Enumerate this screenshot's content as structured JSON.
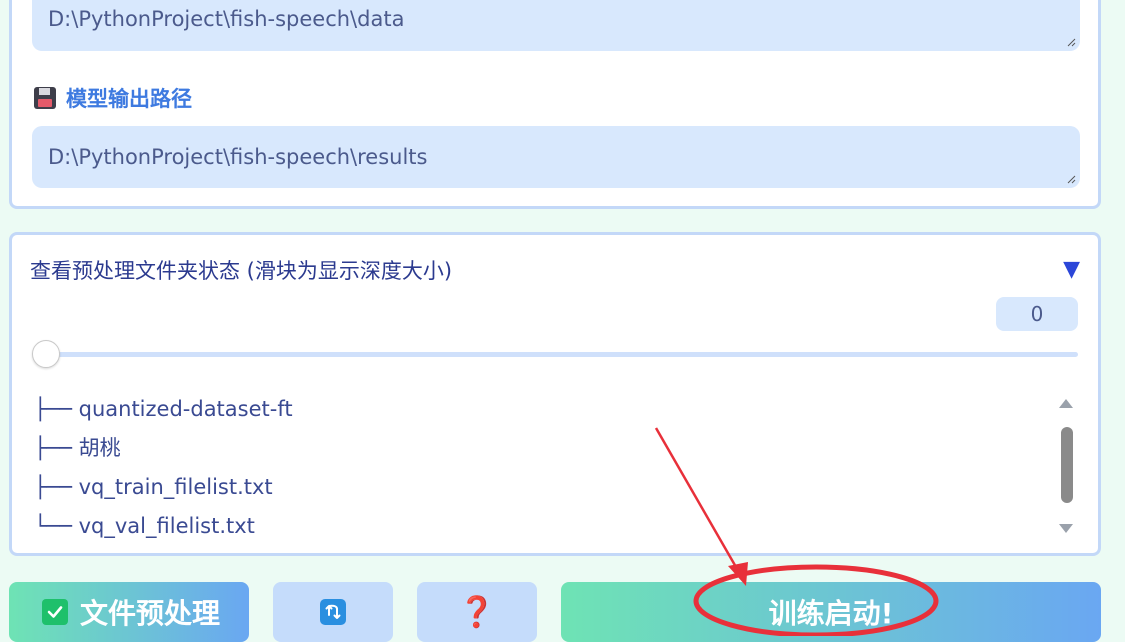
{
  "paths": {
    "data_dir_value": "D:\\PythonProject\\fish-speech\\data",
    "output_label": "模型输出路径",
    "output_dir_value": "D:\\PythonProject\\fish-speech\\results"
  },
  "tree_panel": {
    "header": "查看预处理文件夹状态 (滑块为显示深度大小)",
    "toggle_symbol": "▼",
    "depth_value": "0",
    "slider_level": 0,
    "entries": [
      {
        "branch": "├──",
        "name": "quantized-dataset-ft"
      },
      {
        "branch": "├──",
        "name": "胡桃"
      },
      {
        "branch": "├──",
        "name": "vq_train_filelist.txt"
      },
      {
        "branch": "└──",
        "name": "vq_val_filelist.txt"
      }
    ]
  },
  "buttons": {
    "preprocess_label": "文件预处理",
    "help_symbol": "❓",
    "train_label": "训练启动!"
  },
  "icons": {
    "floppy": "floppy-disk-icon",
    "check": "check-mark-icon",
    "refresh": "refresh-icon",
    "help": "question-mark-icon"
  },
  "colors": {
    "accent_blue": "#3e7ae0",
    "annotation_red": "#e8303a",
    "gradient_start": "#6ee3b4",
    "gradient_end": "#6aa7f2"
  }
}
